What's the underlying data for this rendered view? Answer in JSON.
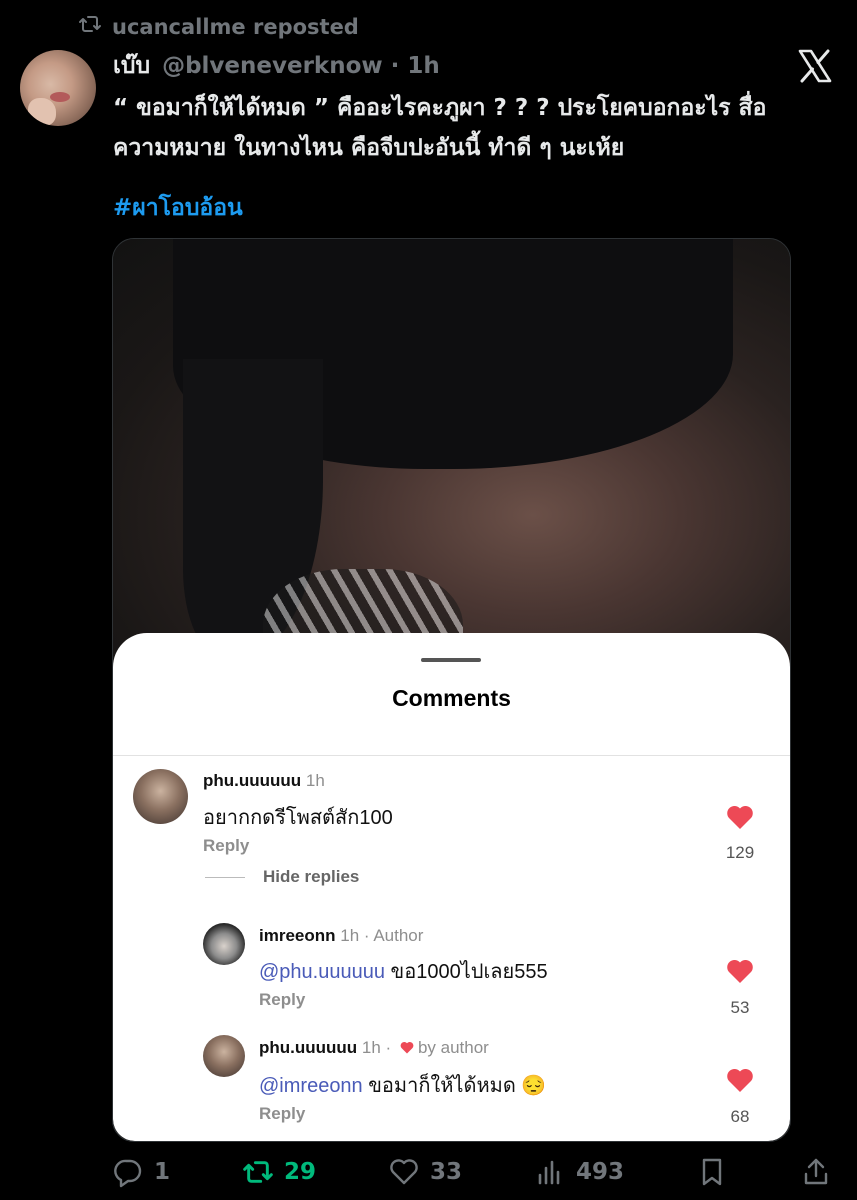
{
  "repost": {
    "text": "ucancallme reposted"
  },
  "tweet": {
    "display_name": "เบ๊บ",
    "handle": "@blveneverknow · 1h",
    "text_line1": "“ ขอมาก็ให้ได้หมด ” คืออะไรคะภูผา ? ? ? ประโยคบอกอะไร สื่อ",
    "text_line2": "ความหมาย ในทางไหน คือจีบปะอันนี้ ทำดี ๆ นะเห้ย",
    "hashtag": "#ผาโอบอ้อน"
  },
  "comments_sheet": {
    "title": "Comments",
    "comments": [
      {
        "user": "phu.uuuuuu",
        "time": " 1h",
        "text": "อยากกดรีโพสต์สัก100",
        "reply_label": "Reply",
        "likes": "129"
      }
    ],
    "hide_replies_label": "Hide replies",
    "replies": [
      {
        "user": "imreeonn",
        "time": " 1h · Author",
        "mention": "@phu.uuuuuu",
        "text": " ขอ1000ไปเลย555",
        "reply_label": "Reply",
        "likes": "53"
      },
      {
        "user": "phu.uuuuuu",
        "time": " 1h · ",
        "liked_by": "by author",
        "mention": "@imreeonn",
        "text": " ขอมาก็ให้ได้หมด 😔",
        "reply_label": "Reply",
        "likes": "68"
      }
    ]
  },
  "actions": {
    "replies": "1",
    "reposts": "29",
    "likes": "33",
    "views": "493"
  },
  "colors": {
    "link": "#1d9bf0",
    "repost_green": "#00ba7c",
    "heart_red": "#ed4956",
    "muted": "#71767b"
  },
  "icons": [
    "repost-icon",
    "x-logo-icon",
    "reply-icon",
    "like-icon",
    "views-icon",
    "bookmark-icon",
    "share-icon",
    "heart-icon"
  ]
}
